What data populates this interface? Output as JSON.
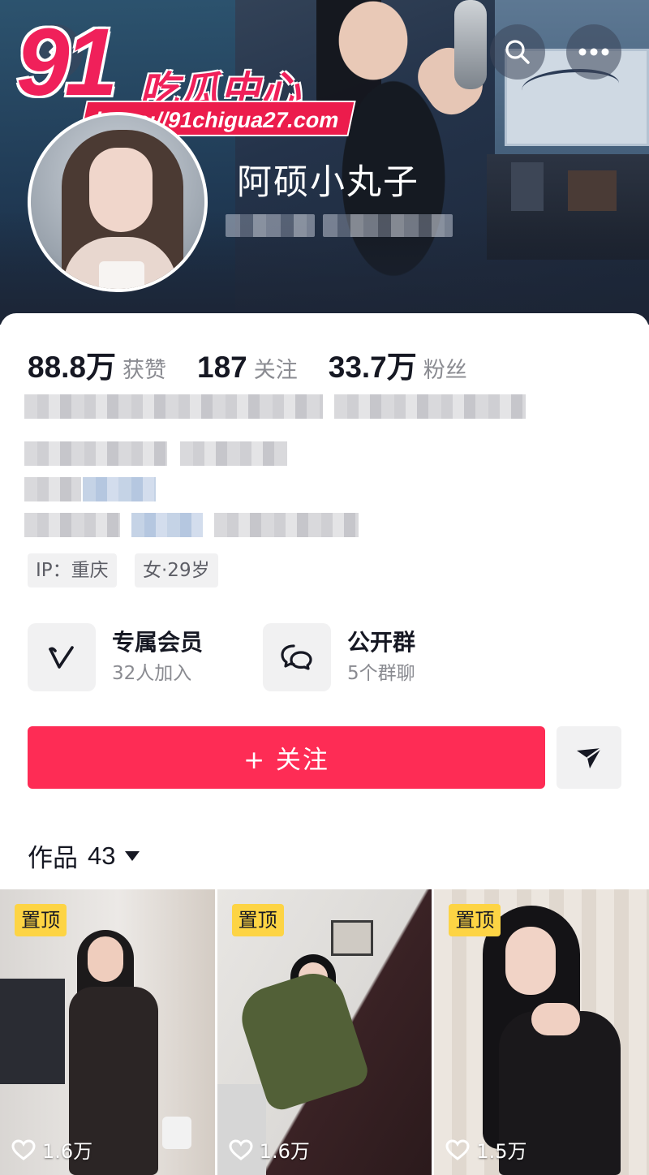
{
  "header": {
    "watermark": {
      "number": "91",
      "name": "吃瓜中心",
      "url": "https://91chigua27.com"
    },
    "username": "阿硕小丸子"
  },
  "stats": [
    {
      "value": "88.8万",
      "label": "获赞"
    },
    {
      "value": "187",
      "label": "关注"
    },
    {
      "value": "33.7万",
      "label": "粉丝"
    }
  ],
  "tags": {
    "ip": "IP：重庆",
    "profile": "女·29岁"
  },
  "features": [
    {
      "title": "专属会员",
      "subtitle": "32人加入",
      "icon": "v-icon"
    },
    {
      "title": "公开群",
      "subtitle": "5个群聊",
      "icon": "chat-bubbles-icon"
    }
  ],
  "actions": {
    "follow_label": "+ 关注",
    "share_icon": "send-icon"
  },
  "works": {
    "label": "作品",
    "count": "43"
  },
  "videos": [
    {
      "pinned_label": "置顶",
      "likes": "1.6万"
    },
    {
      "pinned_label": "置顶",
      "likes": "1.6万"
    },
    {
      "pinned_label": "置顶",
      "likes": "1.5万"
    }
  ],
  "colors": {
    "follow": "#fe2c55",
    "pin": "#fdd444",
    "watermark": "#f0205a"
  }
}
